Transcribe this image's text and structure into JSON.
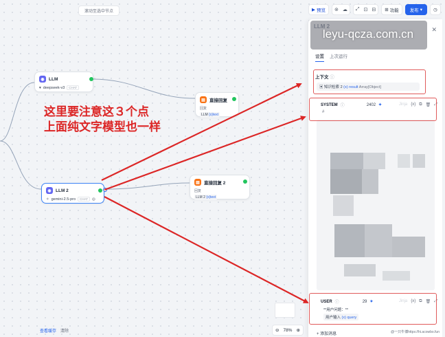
{
  "canvas": {
    "hint": "滚动至选中节点",
    "bottom_links": {
      "cache": "查看缓存",
      "clear": "清除"
    },
    "zoom": {
      "value": "78%"
    }
  },
  "toolbar": {
    "preview": "预览",
    "features": "功能",
    "publish": "发布"
  },
  "nodes": {
    "llm1": {
      "title": "LLM",
      "model": "deepseek-v3",
      "chip": "CHAT"
    },
    "llm2": {
      "title": "LLM 2",
      "model": "gemini-2.5-pro",
      "chip": "CHAT"
    },
    "reply1": {
      "title": "直接回复",
      "label": "回复",
      "src": "LLM",
      "var": "{x}text"
    },
    "reply2": {
      "title": "直接回复 2",
      "label": "回复",
      "src": "LLM 2",
      "var": "{x}text"
    }
  },
  "panel": {
    "title_partial": "LLM 2",
    "tabs": {
      "settings": "设置",
      "last_run": "上次运行"
    },
    "context": {
      "label": "上下文",
      "source": "知识检索 2",
      "var": "(x) result",
      "type": "Array[Object]"
    },
    "system": {
      "label": "SYSTEM",
      "count": "2402",
      "jinja": "Jinja",
      "hash": "#"
    },
    "user": {
      "label": "USER",
      "count": "29",
      "jinja": "Jinja",
      "line1": "**用户问题：**",
      "source": "用户输入",
      "var": "(x) query"
    },
    "add_message": "+ 添加消息"
  },
  "watermark": "leyu-qcza.com.cn",
  "annotation": {
    "line1": "这里要注意这３个点",
    "line2": "上面纯文字模型也一样"
  },
  "credit": "@一只牛博https://hi.acowbo.fun",
  "colors": {
    "annotation_red": "#dc2626",
    "accent": "#2563eb"
  }
}
